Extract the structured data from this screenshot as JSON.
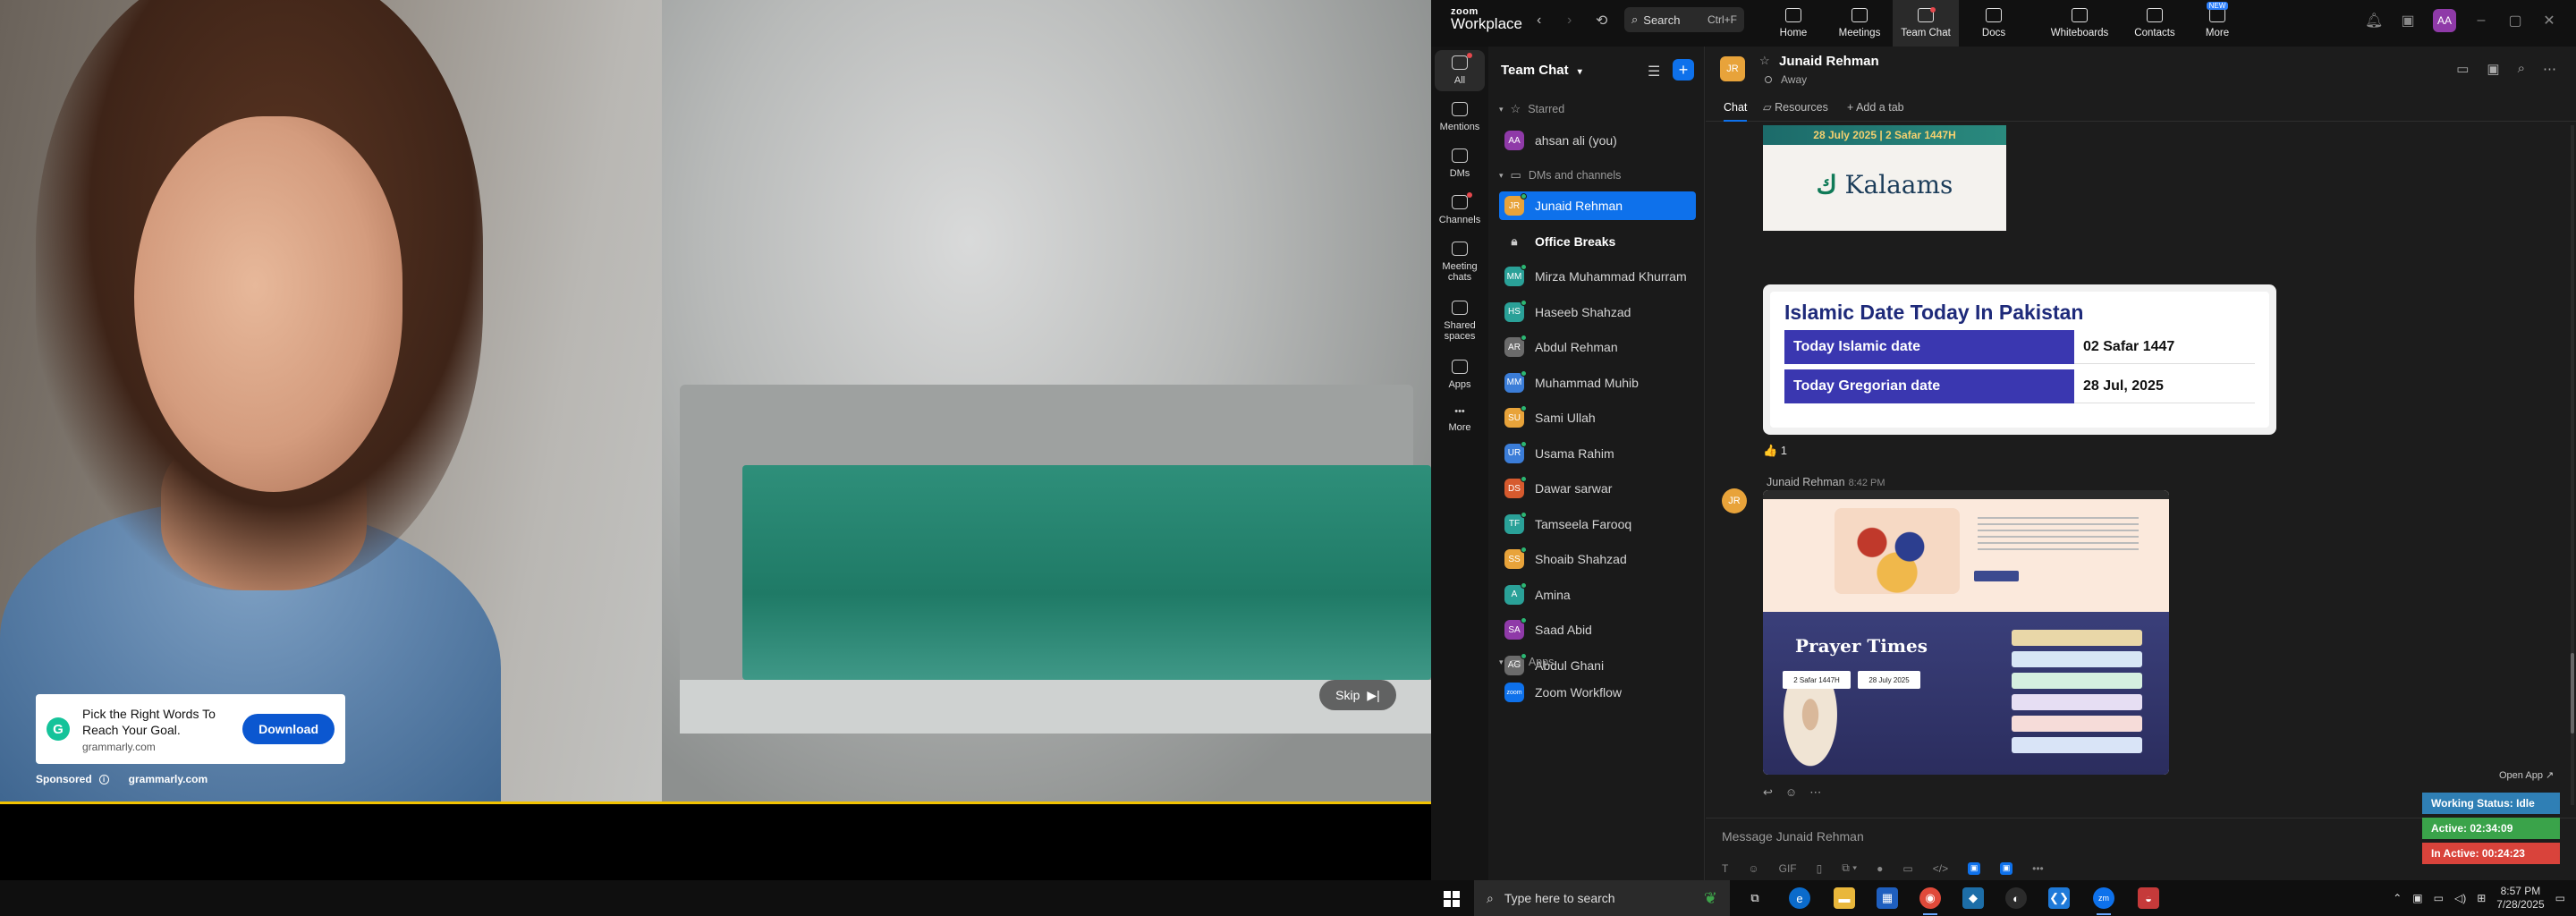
{
  "ad": {
    "headline": "Pick the Right Words To Reach Your Goal.",
    "domain": "grammarly.com",
    "cta": "Download",
    "sponsored": "Sponsored",
    "source": "grammarly.com",
    "skip": "Skip",
    "logo_letter": "G"
  },
  "zoom": {
    "brand_line1": "zoom",
    "brand_line2": "Workplace",
    "search_label": "Search",
    "search_shortcut": "Ctrl+F",
    "nav": [
      {
        "label": "Home",
        "icon": "home-icon"
      },
      {
        "label": "Meetings",
        "icon": "video-icon"
      },
      {
        "label": "Team Chat",
        "icon": "chat-icon"
      },
      {
        "label": "Docs",
        "icon": "doc-icon"
      },
      {
        "label": "Whiteboards",
        "icon": "whiteboard-icon"
      },
      {
        "label": "Contacts",
        "icon": "contacts-icon"
      },
      {
        "label": "More",
        "icon": "more-icon",
        "badge": "NEW"
      }
    ],
    "user_initials": "AA",
    "rail": [
      {
        "label": "All"
      },
      {
        "label": "Mentions"
      },
      {
        "label": "DMs"
      },
      {
        "label": "Channels"
      },
      {
        "label": "Meeting chats"
      },
      {
        "label": "Shared spaces"
      },
      {
        "label": "Apps"
      },
      {
        "label": "More"
      }
    ],
    "chatlist": {
      "title": "Team Chat",
      "sections": {
        "starred": "Starred",
        "dms": "DMs and channels",
        "apps": "Apps"
      },
      "starred_item": {
        "name": "ahsan ali (you)",
        "initials": "AA",
        "color": "#8f3aa8"
      },
      "items": [
        {
          "name": "Junaid Rehman",
          "initials": "JR",
          "color": "#e8a33a"
        },
        {
          "name": "Office Breaks",
          "initials": "",
          "color": ""
        },
        {
          "name": "Mirza Muhammad Khurram",
          "initials": "MM",
          "color": "#2aa198"
        },
        {
          "name": "Haseeb Shahzad",
          "initials": "HS",
          "color": "#2aa198"
        },
        {
          "name": "Abdul Rehman",
          "initials": "AR",
          "color": "#6b6b6b"
        },
        {
          "name": "Muhammad Muhib",
          "initials": "MM",
          "color": "#3b7dd8"
        },
        {
          "name": "Sami Ullah",
          "initials": "SU",
          "color": "#e8a33a"
        },
        {
          "name": "Usama Rahim",
          "initials": "UR",
          "color": "#3b7dd8"
        },
        {
          "name": "Dawar sarwar",
          "initials": "DS",
          "color": "#d65a2e"
        },
        {
          "name": "Tamseela Farooq",
          "initials": "TF",
          "color": "#2aa198"
        },
        {
          "name": "Shoaib Shahzad",
          "initials": "SS",
          "color": "#e8a33a"
        },
        {
          "name": "Amina",
          "initials": "A",
          "color": "#2aa198"
        },
        {
          "name": "Saad Abid",
          "initials": "SA",
          "color": "#8f3aa8"
        },
        {
          "name": "Abdul Ghani",
          "initials": "AG",
          "color": "#6b6b6b"
        }
      ],
      "app_item": {
        "name": "Zoom Workflow",
        "initials": "zoom",
        "color": "#0e71eb"
      }
    },
    "pane": {
      "contact_name": "Junaid Rehman",
      "contact_initials": "JR",
      "status": "Away",
      "tabs": [
        "Chat",
        "Resources",
        "Add a tab"
      ],
      "kalaams_date": "28 July 2025 | 2 Safar 1447H",
      "kalaams_logo": "Kalaams",
      "islamic_card": {
        "title": "Islamic Date Today In Pakistan",
        "rows": [
          {
            "label": "Today Islamic date",
            "value": "02 Safar 1447"
          },
          {
            "label": "Today Gregorian date",
            "value": "28 Jul, 2025"
          }
        ]
      },
      "reaction": "👍 1",
      "msg2_sender": "Junaid Rehman",
      "msg2_time": "8:42 PM",
      "prayer_title": "Prayer Times",
      "prayer_btn1": "2 Safar 1447H",
      "prayer_btn2": "28 July 2025",
      "compose_placeholder": "Message Junaid Rehman"
    }
  },
  "widget": {
    "open_app": "Open App ↗",
    "working": "Working Status: Idle",
    "active": "Active: 02:34:09",
    "inactive": "In Active: 00:24:23"
  },
  "taskbar": {
    "search_placeholder": "Type here to search",
    "time": "8:57 PM",
    "date": "7/28/2025"
  }
}
